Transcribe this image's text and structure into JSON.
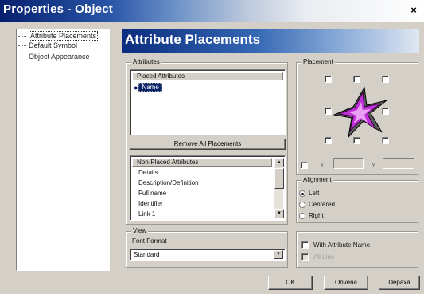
{
  "window": {
    "title": "Properties - Object",
    "close_glyph": "×"
  },
  "nav": {
    "items": [
      {
        "label": "Attribute Placements"
      },
      {
        "label": "Default Symbol"
      },
      {
        "label": "Object Appearance"
      }
    ]
  },
  "header": {
    "title": "Attribute Placements"
  },
  "attributes": {
    "group_label": "Attributes",
    "placed_header": "Placed Attributes",
    "placed_items": [
      "Name"
    ],
    "remove_all_label": "Remove All Placements",
    "nonplaced_header": "Non-Placed Attributes",
    "nonplaced_items": [
      "Details",
      "Description/Definition",
      "Full name",
      "Identifier",
      "Link 1"
    ]
  },
  "placement": {
    "group_label": "Placement",
    "x_label": "X",
    "y_label": "Y",
    "x_value": "",
    "y_value": ""
  },
  "alignment": {
    "group_label": "Alignment",
    "options": [
      "Left",
      "Centered",
      "Right"
    ],
    "selected": "Left"
  },
  "view": {
    "group_label": "View",
    "font_format_label": "Font Format",
    "font_format_value": "Standard"
  },
  "options": {
    "with_attribute_name_label": "With Attribute Name",
    "all_label": "All Line"
  },
  "buttons": {
    "ok": "OK",
    "apply": "Onvena",
    "cancel": "Depaxa"
  },
  "colors": {
    "title_bar_start": "#06206e",
    "header_banner_start": "#0b2c7e",
    "selection": "#0a246a",
    "star_fill": "#c030d8",
    "dialog_face": "#d4d0c8"
  },
  "icons": {
    "placed_item": "bullet-icon",
    "preview": "star-icon"
  }
}
